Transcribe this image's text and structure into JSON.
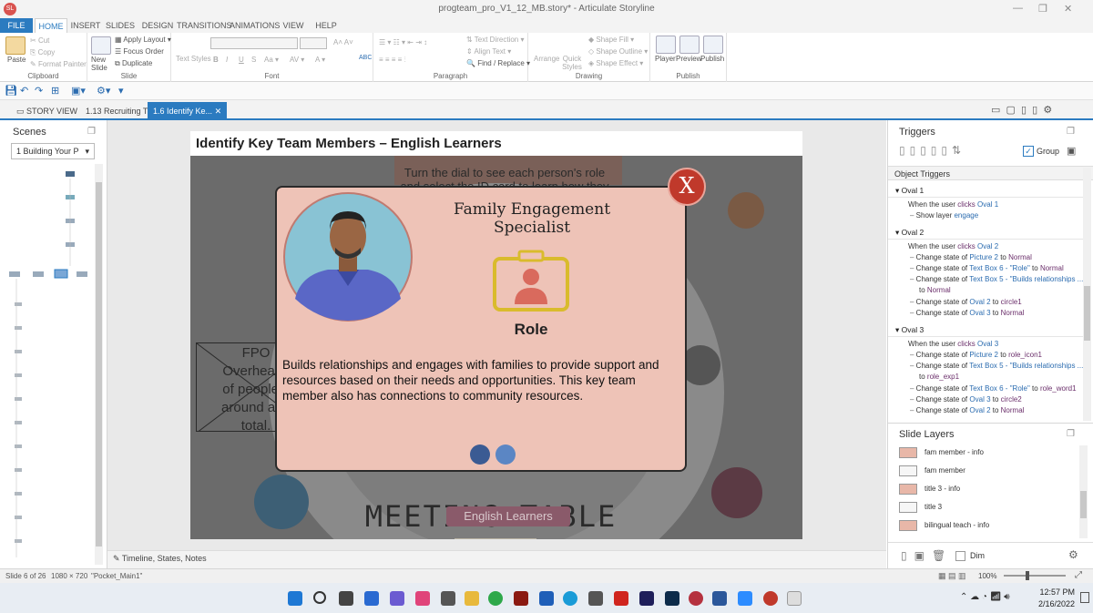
{
  "app": {
    "window_title": "progteam_pro_V1_12_MB.story* - Articulate Storyline",
    "logo_text": "SL"
  },
  "ribbon_tabs": [
    "FILE",
    "HOME",
    "INSERT",
    "SLIDES",
    "DESIGN",
    "TRANSITIONS",
    "ANIMATIONS",
    "VIEW",
    "HELP"
  ],
  "ribbon": {
    "clipboard": {
      "label": "Clipboard",
      "paste": "Paste",
      "cut": "Cut",
      "copy": "Copy",
      "format_painter": "Format Painter"
    },
    "slide": {
      "label": "Slide",
      "new_slide": "New Slide",
      "apply_layout": "Apply Layout",
      "focus_order": "Focus Order",
      "duplicate": "Duplicate"
    },
    "font": {
      "label": "Font",
      "text_styles": "Text Styles",
      "spell": "ABC"
    },
    "paragraph": {
      "label": "Paragraph",
      "text_direction": "Text Direction",
      "align_text": "Align Text",
      "find_replace": "Find / Replace"
    },
    "drawing": {
      "label": "Drawing",
      "arrange": "Arrange",
      "quick_styles": "Quick Styles",
      "shape_fill": "Shape Fill",
      "shape_outline": "Shape Outline",
      "shape_effect": "Shape Effect"
    },
    "publish": {
      "label": "Publish",
      "player": "Player",
      "preview": "Preview",
      "publish": "Publish"
    }
  },
  "doc_tabs": [
    {
      "label": "STORY VIEW"
    },
    {
      "label": "1.13 Recruiting T..."
    },
    {
      "label": "1.6 Identify Ke..."
    }
  ],
  "scenes": {
    "title": "Scenes",
    "selected": "1 Building Your P"
  },
  "slide": {
    "header": "Identify Key Team Members – English Learners",
    "bg_instruction_line1": "Turn the dial to see each person's role",
    "bg_instruction_line2": "and select the ID card to learn how they",
    "fpo_lines": [
      "FPO",
      "Overhead i",
      "of people s",
      "around a ta",
      "total."
    ],
    "meeting_table": "MEETING TABLE",
    "english_learners_btn": "English Learners",
    "popup": {
      "title": "Family Engagement Specialist",
      "role_label": "Role",
      "body": "Builds relationships and engages with families to provide support and resources based on their needs and opportunities. This key team member also has connections to community resources.",
      "close_glyph": "X"
    }
  },
  "bottom_bar": {
    "label": "Timeline, States, Notes"
  },
  "triggers": {
    "title": "Triggers",
    "group_label": "Group",
    "object_triggers_label": "Object Triggers",
    "groups": [
      {
        "name": "Oval 1",
        "rows": [
          {
            "indent": 0,
            "parts": [
              [
                "t",
                "When the user "
              ],
              [
                "v",
                "clicks "
              ],
              [
                "l",
                "Oval 1"
              ]
            ]
          },
          {
            "indent": 1,
            "parts": [
              [
                "t",
                "Show layer "
              ],
              [
                "l",
                "engage"
              ]
            ]
          }
        ]
      },
      {
        "name": "Oval 2",
        "rows": [
          {
            "indent": 0,
            "parts": [
              [
                "t",
                "When the user "
              ],
              [
                "v",
                "clicks "
              ],
              [
                "l",
                "Oval 2"
              ]
            ]
          },
          {
            "indent": 1,
            "parts": [
              [
                "t",
                "Change state of "
              ],
              [
                "l",
                "Picture 2"
              ],
              [
                "t",
                " to "
              ],
              [
                "v",
                "Normal"
              ]
            ]
          },
          {
            "indent": 1,
            "parts": [
              [
                "t",
                "Change state of "
              ],
              [
                "l",
                "Text Box 6 - \"Role\""
              ],
              [
                "t",
                " to "
              ],
              [
                "v",
                "Normal"
              ]
            ]
          },
          {
            "indent": 1,
            "parts": [
              [
                "t",
                "Change state of "
              ],
              [
                "l",
                "Text Box 5 - \"Builds relationships ..."
              ]
            ]
          },
          {
            "indent": 2,
            "parts": [
              [
                "t",
                "to "
              ],
              [
                "v",
                "Normal"
              ]
            ]
          },
          {
            "indent": 1,
            "parts": [
              [
                "t",
                "Change state of "
              ],
              [
                "l",
                "Oval 2"
              ],
              [
                "t",
                " to "
              ],
              [
                "v",
                "circle1"
              ]
            ]
          },
          {
            "indent": 1,
            "parts": [
              [
                "t",
                "Change state of "
              ],
              [
                "l",
                "Oval 3"
              ],
              [
                "t",
                " to "
              ],
              [
                "v",
                "Normal"
              ]
            ]
          }
        ]
      },
      {
        "name": "Oval 3",
        "rows": [
          {
            "indent": 0,
            "parts": [
              [
                "t",
                "When the user "
              ],
              [
                "v",
                "clicks "
              ],
              [
                "l",
                "Oval 3"
              ]
            ]
          },
          {
            "indent": 1,
            "parts": [
              [
                "t",
                "Change state of "
              ],
              [
                "l",
                "Picture 2"
              ],
              [
                "t",
                " to "
              ],
              [
                "v",
                "role_icon1"
              ]
            ]
          },
          {
            "indent": 1,
            "parts": [
              [
                "t",
                "Change state of "
              ],
              [
                "l",
                "Text Box 5 - \"Builds relationships ..."
              ]
            ]
          },
          {
            "indent": 2,
            "parts": [
              [
                "t",
                "to "
              ],
              [
                "v",
                "role_exp1"
              ]
            ]
          },
          {
            "indent": 1,
            "parts": [
              [
                "t",
                "Change state of "
              ],
              [
                "l",
                "Text Box 6 - \"Role\""
              ],
              [
                "t",
                " to "
              ],
              [
                "v",
                "role_word1"
              ]
            ]
          },
          {
            "indent": 1,
            "parts": [
              [
                "t",
                "Change state of "
              ],
              [
                "l",
                "Oval 3"
              ],
              [
                "t",
                " to "
              ],
              [
                "v",
                "circle2"
              ]
            ]
          },
          {
            "indent": 1,
            "parts": [
              [
                "t",
                "Change state of "
              ],
              [
                "l",
                "Oval 2"
              ],
              [
                "t",
                " to "
              ],
              [
                "v",
                "Normal"
              ]
            ]
          }
        ]
      }
    ]
  },
  "slide_layers": {
    "title": "Slide Layers",
    "items": [
      "fam member - info",
      "fam member",
      "title 3 - info",
      "title 3",
      "bilingual teach - info"
    ],
    "dim_label": "Dim"
  },
  "status_bar": {
    "slide_of": "Slide 6 of 26",
    "size": "1080 × 720",
    "player": "\"Pocket_Main1\"",
    "zoom": "100%"
  },
  "taskbar": {
    "time": "12:57 PM",
    "date": "2/16/2022"
  },
  "colors": {
    "accent": "#2b7bc0",
    "popup_bg": "#eec3b7",
    "close_red": "#c0392b",
    "trigger_link": "#2b6cb0",
    "trigger_value": "#6b2f6b"
  }
}
